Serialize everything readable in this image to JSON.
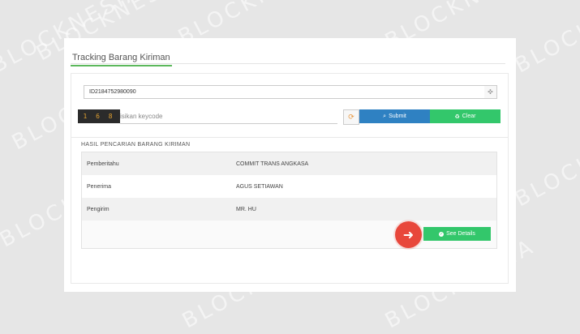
{
  "watermark": {
    "text": "BLOCKNESIA"
  },
  "page": {
    "title": "Tracking Barang Kiriman"
  },
  "form": {
    "tracking_number": "ID2184752980090",
    "captcha_code": "1 6 8",
    "keycode_placeholder": "isikan keycode",
    "submit_label": "Submit",
    "clear_label": "Clear"
  },
  "results": {
    "title": "HASIL PENCARIAN BARANG KIRIMAN",
    "rows": [
      {
        "label": "Pemberitahu",
        "value": "COMMIT TRANS ANGKASA"
      },
      {
        "label": "Penerima",
        "value": "AGUS SETIAWAN"
      },
      {
        "label": "Pengirim",
        "value": "MR. HU"
      }
    ],
    "details_label": "See Details"
  },
  "colors": {
    "submit": "#2f81c2",
    "clear": "#33c76b",
    "details": "#33c76b",
    "arrow": "#e8473b",
    "title_underline": "#5cb85c"
  },
  "icons": {
    "track_button": "crosshair-icon",
    "refresh": "refresh-icon",
    "submit": "search-icon",
    "clear": "recycle-icon",
    "details": "check-circle-icon",
    "annotation": "arrow-right-icon"
  }
}
